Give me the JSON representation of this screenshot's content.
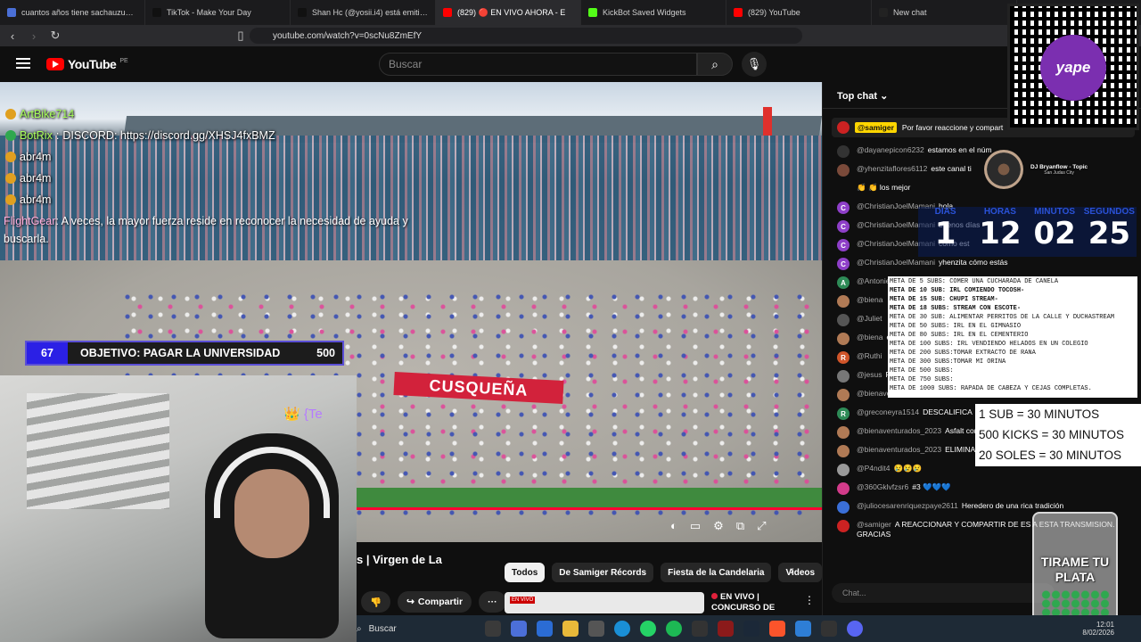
{
  "browser": {
    "tabs": [
      {
        "title": "cuantos años tiene sachauzumaki - B",
        "color": "#4a6fd6"
      },
      {
        "title": "TikTok - Make Your Day",
        "color": "#111111"
      },
      {
        "title": "Shan Hc (@yosii.i4) está emitiendo L",
        "color": "#111111"
      },
      {
        "title": "(829) 🔴 EN VIVO AHORA - E",
        "color": "#ff0000"
      },
      {
        "title": "KickBot Saved Widgets",
        "color": "#53fc18"
      },
      {
        "title": "(829) YouTube",
        "color": "#ff0000"
      },
      {
        "title": "New chat",
        "color": "#222222"
      }
    ],
    "url": "youtube.com/watch?v=0scNu8ZmEfY"
  },
  "yt": {
    "logo_word": "YouTube",
    "country": "PE",
    "search_placeholder": "Buscar"
  },
  "video": {
    "sponsor_banner": "CUSQUEÑA",
    "progress_pct": 100
  },
  "overlay_chat": [
    {
      "user": "ArtBike714",
      "text": "",
      "color": "#a8ff5a"
    },
    {
      "user": "BotRix",
      "text": "DISCORD: https://discord.gg/XHSJ4fxBMZ",
      "color": "#a8ff5a"
    },
    {
      "user": "abr4m",
      "text": "",
      "color": "#ffffff"
    },
    {
      "user": "abr4m",
      "text": "",
      "color": "#ffffff"
    },
    {
      "user": "abr4m",
      "text": "",
      "color": "#ffffff"
    }
  ],
  "overlay_footer": {
    "user": "FlightGear",
    "text": "A veces, la mayor fuerza reside en reconocer la necesidad de ayuda y buscarla."
  },
  "goal": {
    "current": "67",
    "label": "OBJETIVO: PAGAR LA UNIVERSIDAD",
    "target": "500"
  },
  "cam_overlay": "{Te",
  "below": {
    "title_fragment": "s | Virgen de La",
    "chips": [
      "Todos",
      "De Samiger Récords",
      "Fiesta de la Candelaria",
      "Videos"
    ],
    "share_label": "Compartir",
    "upnext_live": "EN VIVO |",
    "upnext_title": "CONCURSO DE",
    "thumb_tag": "EN VIVO"
  },
  "taskbar": {
    "search": "Buscar",
    "time": "12:01",
    "date": "8/02/2026"
  },
  "chat": {
    "header": "Top chat",
    "pinned_user": "@samiger",
    "pinned_text": "Por favor reaccione y compart",
    "input_placeholder": "Chat...",
    "messages": [
      {
        "user": "@dayanepicon6232",
        "text": "estamos en el núm",
        "av": "#333",
        "ini": ""
      },
      {
        "user": "@yhenzitaflores6112",
        "text": "este canal ti",
        "av": "#7a4a3a",
        "ini": ""
      },
      {
        "user": "",
        "text": "👏 👏 los mejor",
        "av": "",
        "ini": ""
      },
      {
        "user": "@ChristianJoelMamani",
        "text": "hola",
        "av": "#8e3fc8",
        "ini": "C"
      },
      {
        "user": "@ChristianJoelMamani",
        "text": "buenos días",
        "av": "#8e3fc8",
        "ini": "C"
      },
      {
        "user": "@ChristianJoelMamani",
        "text": "cómo est",
        "av": "#8e3fc8",
        "ini": "C"
      },
      {
        "user": "@ChristianJoelMamani",
        "text": "yhenzita cómo estás",
        "av": "#8e3fc8",
        "ini": "C"
      },
      {
        "user": "@AntonietaFannyRozadoOre",
        "text": "saludos al conjunto Morenada san Antonio",
        "av": "#2e8b57",
        "ini": "A"
      },
      {
        "user": "@biena",
        "text": "🙏",
        "av": "#b07a55",
        "ini": ""
      },
      {
        "user": "@Juliet",
        "text": "",
        "av": "#555",
        "ini": ""
      },
      {
        "user": "@biena",
        "text": "estadio",
        "av": "#b07a55",
        "ini": ""
      },
      {
        "user": "@Ruthi",
        "text": "",
        "av": "#d0552a",
        "ini": "R"
      },
      {
        "user": "@jesus",
        "text": "PUNO",
        "av": "#777",
        "ini": ""
      },
      {
        "user": "@bienaventurados_2023",
        "text": "poner",
        "av": "#b07a55",
        "ini": ""
      },
      {
        "user": "@greconeyra1514",
        "text": "DESCALIFICA",
        "av": "#2e8b57",
        "ini": "R"
      },
      {
        "user": "@bienaventurados_2023",
        "text": "Asfalt con monitores mediante publicid",
        "av": "#b07a55",
        "ini": ""
      },
      {
        "user": "@bienaventurados_2023",
        "text": "ELIMINADOS",
        "av": "#b07a55",
        "ini": ""
      },
      {
        "user": "@P4ndit4",
        "text": "😢😢😢",
        "av": "#999",
        "ini": ""
      },
      {
        "user": "@360Gklvfzsr6",
        "text": "#3 💙💙💙",
        "av": "#d23b8a",
        "ini": ""
      },
      {
        "user": "@juliocesarenriquezpaye2611",
        "text": "Heredero de una rica tradición",
        "av": "#3a6fd8",
        "ini": ""
      },
      {
        "user": "@samiger",
        "text": "A REACCIONAR Y COMPARTIR DE ES A ESTA TRANSMISION. GRACIAS",
        "av": "#c22",
        "ini": ""
      }
    ]
  },
  "music": {
    "artist": "DJ Bryanflow - Topic",
    "sub": "San Judas City"
  },
  "timer": {
    "labels": [
      "DIAS",
      "HORAS",
      "MINUTOS",
      "SEGUNDOS"
    ],
    "values": [
      "1",
      "12",
      "02",
      "25"
    ]
  },
  "meta_list": [
    "META DE 5 SUBS: COMER UNA CUCHARADA DE CANELA",
    "META DE 10 SUB: IRL COMIENDO TOCOSH-",
    "META DE 15 SUB: CHUPI STREAM-",
    "META DE 18 SUBS: STREAM CON ESCOTE-",
    "META DE 30 SUB:  ALIMENTAR PERRITOS DE LA CALLE Y DUCHASTREAM",
    "META DE 50 SUBS: IRL EN EL GIMNASIO",
    "META DE 80 SUBS: IRL EN EL CEMENTERIO",
    "META DE 100 SUBS: IRL VENDIENDO HELADOS EN UN COLEGIO",
    "META DE 200 SUBS:TOMAR EXTRACTO DE RANA",
    "META DE 300 SUBS:TOMAR MI ORINA",
    "META DE 500 SUBS:",
    "META DE 750 SUBS:",
    "META DE 1000 SUBS: RAPADA DE CABEZA Y CEJAS COMPLETAS."
  ],
  "subs_rules": [
    "1 SUB = 30 MINUTOS",
    "500 KICKS = 30 MINUTOS",
    "20 SOLES = 30 MINUTOS"
  ],
  "tip_jar": "TIRAME TU PLATA",
  "qr_brand": "yape"
}
